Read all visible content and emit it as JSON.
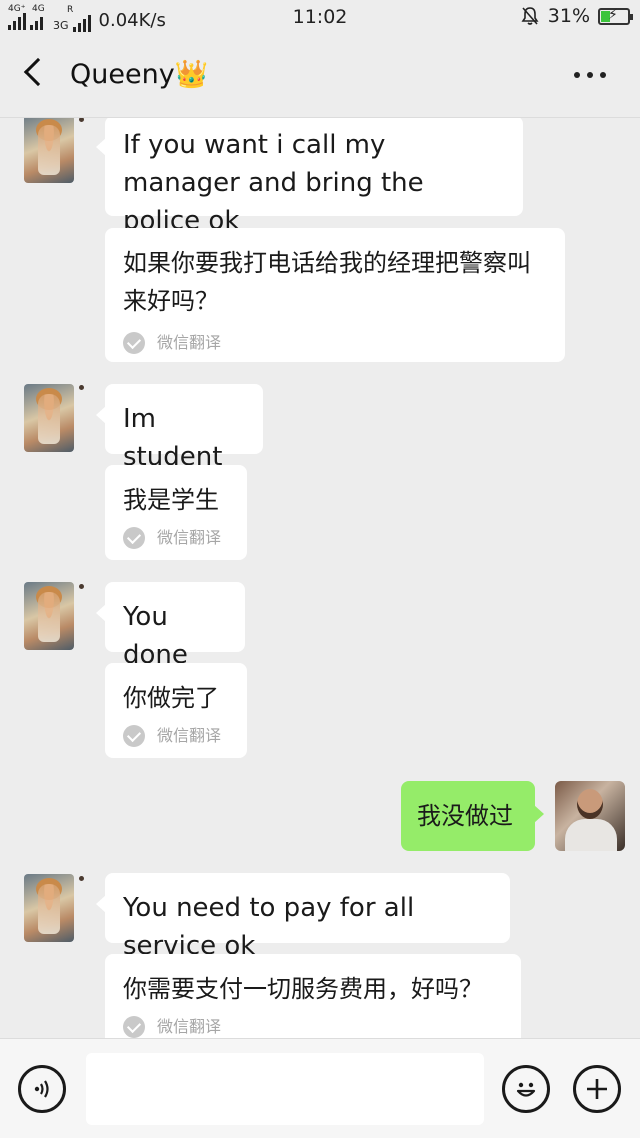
{
  "status_bar": {
    "net1": "4G⁺",
    "net2": "4G",
    "net3": "3G",
    "roaming": "R",
    "speed": "0.04K/s",
    "time": "11:02",
    "battery": "31%"
  },
  "header": {
    "title": "Queeny👑"
  },
  "messages": [
    {
      "text": "If you want i call my manager and bring the police ok"
    },
    {
      "text": "如果你要我打电话给我的经理把警察叫来好吗？",
      "badge": "微信翻译"
    },
    {
      "text": "Im student"
    },
    {
      "text": "我是学生",
      "badge": "微信翻译"
    },
    {
      "text": "You done"
    },
    {
      "text": "你做完了",
      "badge": "微信翻译"
    },
    {
      "text": "我没做过"
    },
    {
      "text": "You need to pay for all service ok"
    },
    {
      "text": "你需要支付一切服务费用，好吗？",
      "badge": "微信翻译"
    }
  ],
  "input": {
    "placeholder": ""
  }
}
